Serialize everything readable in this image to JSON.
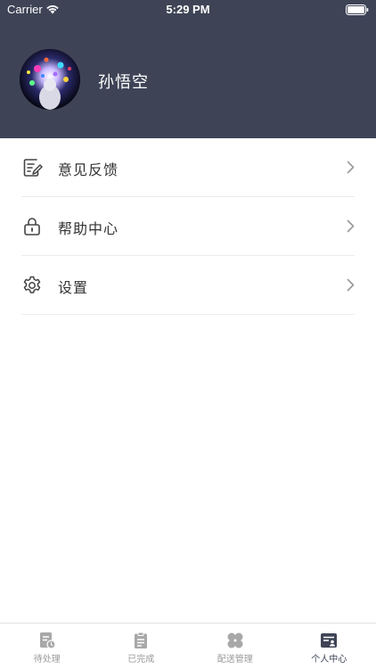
{
  "status_bar": {
    "carrier": "Carrier",
    "time": "5:29 PM"
  },
  "profile": {
    "username": "孙悟空"
  },
  "menu": {
    "items": [
      {
        "label": "意见反馈",
        "icon": "feedback-icon"
      },
      {
        "label": "帮助中心",
        "icon": "lock-icon"
      },
      {
        "label": "设置",
        "icon": "gear-icon"
      }
    ]
  },
  "tabbar": {
    "tabs": [
      {
        "label": "待处理",
        "icon": "pending-icon",
        "active": false
      },
      {
        "label": "已完成",
        "icon": "clipboard-icon",
        "active": false
      },
      {
        "label": "配送管理",
        "icon": "grid-icon",
        "active": false
      },
      {
        "label": "个人中心",
        "icon": "profile-card-icon",
        "active": true
      }
    ]
  },
  "colors": {
    "header": "#3e4456",
    "tab_active": "#3e4456",
    "tab_inactive": "#9a9a9a"
  }
}
